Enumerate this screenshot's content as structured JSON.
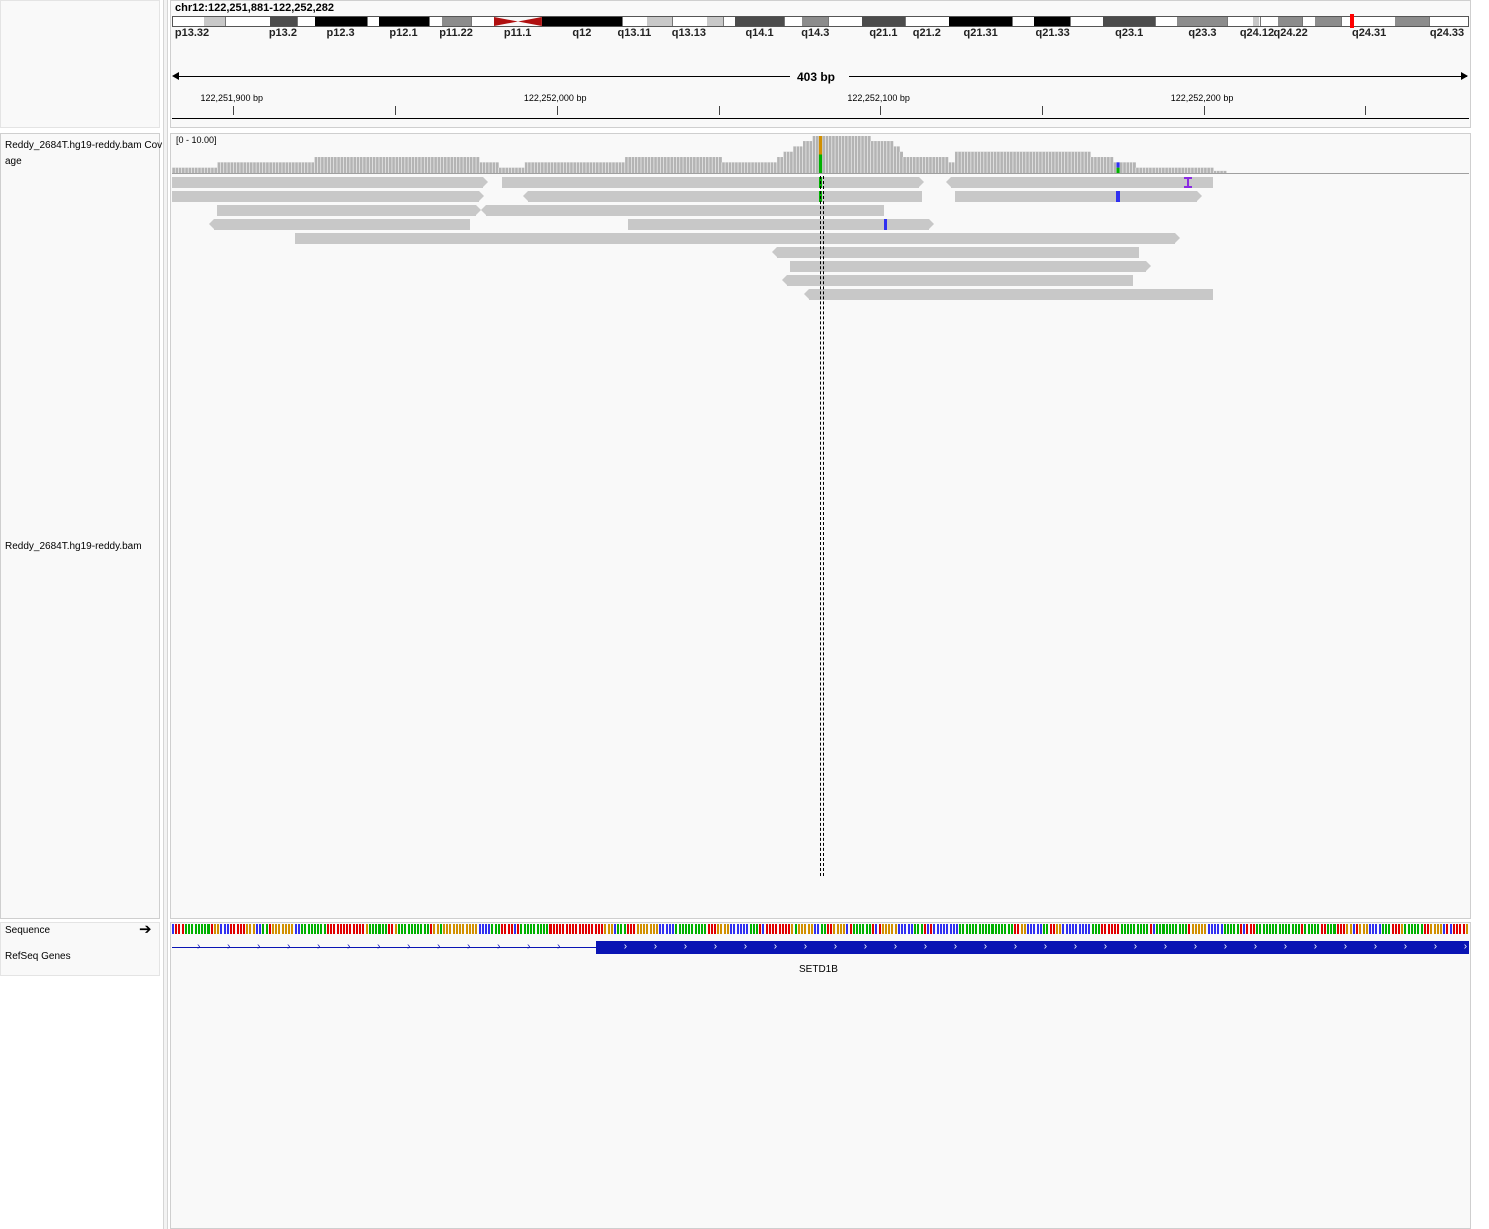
{
  "header": {
    "locus": "chr12:122,251,881-122,252,282",
    "span_label": "403 bp"
  },
  "ideogram": {
    "bands": [
      {
        "name": "p13.32",
        "stain": "gneg",
        "start": 0.0,
        "end": 0.024
      },
      {
        "name": "",
        "stain": "gpos25",
        "start": 0.024,
        "end": 0.04
      },
      {
        "name": "",
        "stain": "gneg",
        "start": 0.04,
        "end": 0.075
      },
      {
        "name": "p13.2",
        "stain": "gpos75",
        "start": 0.075,
        "end": 0.096
      },
      {
        "name": "",
        "stain": "gneg",
        "start": 0.096,
        "end": 0.11
      },
      {
        "name": "p12.3",
        "stain": "gpos100",
        "start": 0.11,
        "end": 0.15
      },
      {
        "name": "",
        "stain": "gneg",
        "start": 0.15,
        "end": 0.159
      },
      {
        "name": "p12.1",
        "stain": "gpos100",
        "start": 0.159,
        "end": 0.198
      },
      {
        "name": "",
        "stain": "gneg",
        "start": 0.198,
        "end": 0.208
      },
      {
        "name": "p11.22",
        "stain": "gpos50",
        "start": 0.208,
        "end": 0.23
      },
      {
        "name": "",
        "stain": "gneg",
        "start": 0.23,
        "end": 0.248
      },
      {
        "name": "p11.1",
        "stain": "acen",
        "start": 0.248,
        "end": 0.285
      },
      {
        "name": "q12",
        "stain": "gpos100",
        "start": 0.285,
        "end": 0.347
      },
      {
        "name": "q13.11",
        "stain": "gneg",
        "start": 0.347,
        "end": 0.366
      },
      {
        "name": "",
        "stain": "gpos25",
        "start": 0.366,
        "end": 0.385
      },
      {
        "name": "q13.13",
        "stain": "gneg",
        "start": 0.385,
        "end": 0.412
      },
      {
        "name": "",
        "stain": "gpos25",
        "start": 0.412,
        "end": 0.425
      },
      {
        "name": "",
        "stain": "gneg",
        "start": 0.425,
        "end": 0.434
      },
      {
        "name": "q14.1",
        "stain": "gpos75",
        "start": 0.434,
        "end": 0.472
      },
      {
        "name": "",
        "stain": "gneg",
        "start": 0.472,
        "end": 0.486
      },
      {
        "name": "q14.3",
        "stain": "gpos50",
        "start": 0.486,
        "end": 0.506
      },
      {
        "name": "",
        "stain": "gneg",
        "start": 0.506,
        "end": 0.532
      },
      {
        "name": "q21.1",
        "stain": "gpos75",
        "start": 0.532,
        "end": 0.565
      },
      {
        "name": "q21.2",
        "stain": "gneg",
        "start": 0.565,
        "end": 0.599
      },
      {
        "name": "q21.31",
        "stain": "gpos100",
        "start": 0.599,
        "end": 0.648
      },
      {
        "name": "",
        "stain": "gneg",
        "start": 0.648,
        "end": 0.665
      },
      {
        "name": "q21.33",
        "stain": "gpos100",
        "start": 0.665,
        "end": 0.693
      },
      {
        "name": "",
        "stain": "gneg",
        "start": 0.693,
        "end": 0.718
      },
      {
        "name": "q23.1",
        "stain": "gpos75",
        "start": 0.718,
        "end": 0.758
      },
      {
        "name": "",
        "stain": "gneg",
        "start": 0.758,
        "end": 0.775
      },
      {
        "name": "q23.3",
        "stain": "gpos50",
        "start": 0.775,
        "end": 0.814
      },
      {
        "name": "",
        "stain": "gneg",
        "start": 0.814,
        "end": 0.834
      },
      {
        "name": "q24.12",
        "stain": "gpos25",
        "start": 0.834,
        "end": 0.839
      },
      {
        "name": "",
        "stain": "gneg",
        "start": 0.839,
        "end": 0.853
      },
      {
        "name": "q24.22",
        "stain": "gpos50",
        "start": 0.853,
        "end": 0.872
      },
      {
        "name": "",
        "stain": "gneg",
        "start": 0.872,
        "end": 0.882
      },
      {
        "name": "",
        "stain": "gpos50",
        "start": 0.882,
        "end": 0.902
      },
      {
        "name": "q24.31",
        "stain": "gneg",
        "start": 0.902,
        "end": 0.944
      },
      {
        "name": "",
        "stain": "gpos50",
        "start": 0.944,
        "end": 0.97
      },
      {
        "name": "q24.33",
        "stain": "gneg",
        "start": 0.97,
        "end": 1.0
      }
    ],
    "current_position": 0.91
  },
  "ruler": {
    "start_bp": 122251881,
    "end_bp": 122252282,
    "tick_labels": [
      {
        "bp": 122251900,
        "label": "122,251,900 bp"
      },
      {
        "bp": 122252000,
        "label": "122,252,000 bp"
      },
      {
        "bp": 122252100,
        "label": "122,252,100 bp"
      },
      {
        "bp": 122252200,
        "label": "122,252,200 bp"
      }
    ],
    "minor_ticks_bp": [
      122251950,
      122252050,
      122252150,
      122252250
    ]
  },
  "tracks": {
    "coverage_name": "Reddy_2684T.hg19-reddy.bam Coverage",
    "coverage_name_line1": "Reddy_2684T.hg19-reddy.bam Cov",
    "coverage_name_line2": "age",
    "coverage_range": "[0 - 10.00]",
    "alignment_name": "Reddy_2684T.hg19-reddy.bam",
    "sequence_name": "Sequence",
    "genes_name": "RefSeq Genes",
    "gene_label": "SETD1B"
  },
  "colors": {
    "coverage_bar": "#b4b4b4",
    "read": "#c8c8c8",
    "gene": "#0a14b4",
    "mismatch_A": "#00b000",
    "mismatch_C": "#3030f0",
    "mismatch_G": "#d18f00",
    "mismatch_T": "#e00000",
    "insertion": "#8a2be2",
    "ideogram_marker": "#ff0000",
    "centromere": "#b01010"
  },
  "chart_data": {
    "type": "area",
    "xlabel": "",
    "ylabel": "",
    "x_range_bp": [
      122251881,
      122252282
    ],
    "ylim": [
      0,
      10
    ],
    "coverage": [
      [
        122251881,
        1
      ],
      [
        122251895,
        2
      ],
      [
        122251925,
        3
      ],
      [
        122251976,
        2
      ],
      [
        122251982,
        1
      ],
      [
        122251990,
        2
      ],
      [
        122252021,
        3
      ],
      [
        122252051,
        2
      ],
      [
        122252068,
        3
      ],
      [
        122252070,
        4
      ],
      [
        122252073,
        5
      ],
      [
        122252076,
        6
      ],
      [
        122252079,
        7
      ],
      [
        122252085,
        7
      ],
      [
        122252097,
        6
      ],
      [
        122252104,
        5
      ],
      [
        122252106,
        4
      ],
      [
        122252107,
        3
      ],
      [
        122252121,
        2
      ],
      [
        122252123,
        4
      ],
      [
        122252165,
        3
      ],
      [
        122252172,
        2
      ],
      [
        122252179,
        1
      ],
      [
        122252197,
        1
      ],
      [
        122252203,
        0.4
      ],
      [
        122252207,
        0
      ]
    ],
    "reads": [
      {
        "row": 0,
        "start": 122251881,
        "end": 122251977,
        "strand": "+"
      },
      {
        "row": 0,
        "start": 122251983,
        "end": 122252112,
        "strand": "+"
      },
      {
        "row": 0,
        "start": 122252122,
        "end": 122252203,
        "strand": "-"
      },
      {
        "row": 1,
        "start": 122251881,
        "end": 122251976,
        "strand": "+"
      },
      {
        "row": 1,
        "start": 122251991,
        "end": 122252113,
        "strand": "-"
      },
      {
        "row": 1,
        "start": 122252123,
        "end": 122252198,
        "strand": "+"
      },
      {
        "row": 2,
        "start": 122251895,
        "end": 122251975,
        "strand": "+"
      },
      {
        "row": 2,
        "start": 122251978,
        "end": 122252101,
        "strand": "-"
      },
      {
        "row": 3,
        "start": 122251894,
        "end": 122251973,
        "strand": "-"
      },
      {
        "row": 3,
        "start": 122252022,
        "end": 122252115,
        "strand": "+"
      },
      {
        "row": 4,
        "start": 122251919,
        "end": 122252085,
        "strand": "+"
      },
      {
        "row": 4,
        "start": 122252070,
        "end": 122252191,
        "strand": "+"
      },
      {
        "row": 5,
        "start": 122252068,
        "end": 122252180,
        "strand": "-"
      },
      {
        "row": 6,
        "start": 122252072,
        "end": 122252182,
        "strand": "+"
      },
      {
        "row": 7,
        "start": 122252071,
        "end": 122252178,
        "strand": "-"
      },
      {
        "row": 8,
        "start": 122252078,
        "end": 122252203,
        "strand": "-"
      }
    ],
    "mismatches": [
      {
        "row": 0,
        "bp": 122252081,
        "base": "A"
      },
      {
        "row": 1,
        "bp": 122252081,
        "base": "A"
      },
      {
        "row": 1,
        "bp": 122252173,
        "base": "C"
      },
      {
        "row": 3,
        "bp": 122252101,
        "base": "C"
      }
    ],
    "insertions": [
      {
        "row": 0,
        "bp": 122252195
      }
    ],
    "coverage_mismatch_columns": [
      {
        "bp": 122252081,
        "bases": [
          "G",
          "A"
        ]
      },
      {
        "bp": 122252173,
        "bases": [
          "C",
          "A"
        ]
      }
    ],
    "center_bp": 122252082,
    "gene": {
      "name": "SETD1B",
      "intron_start_bp": 122251881,
      "exon_start_bp": 122252012,
      "end_bp": 122252282,
      "strand": "+"
    }
  }
}
